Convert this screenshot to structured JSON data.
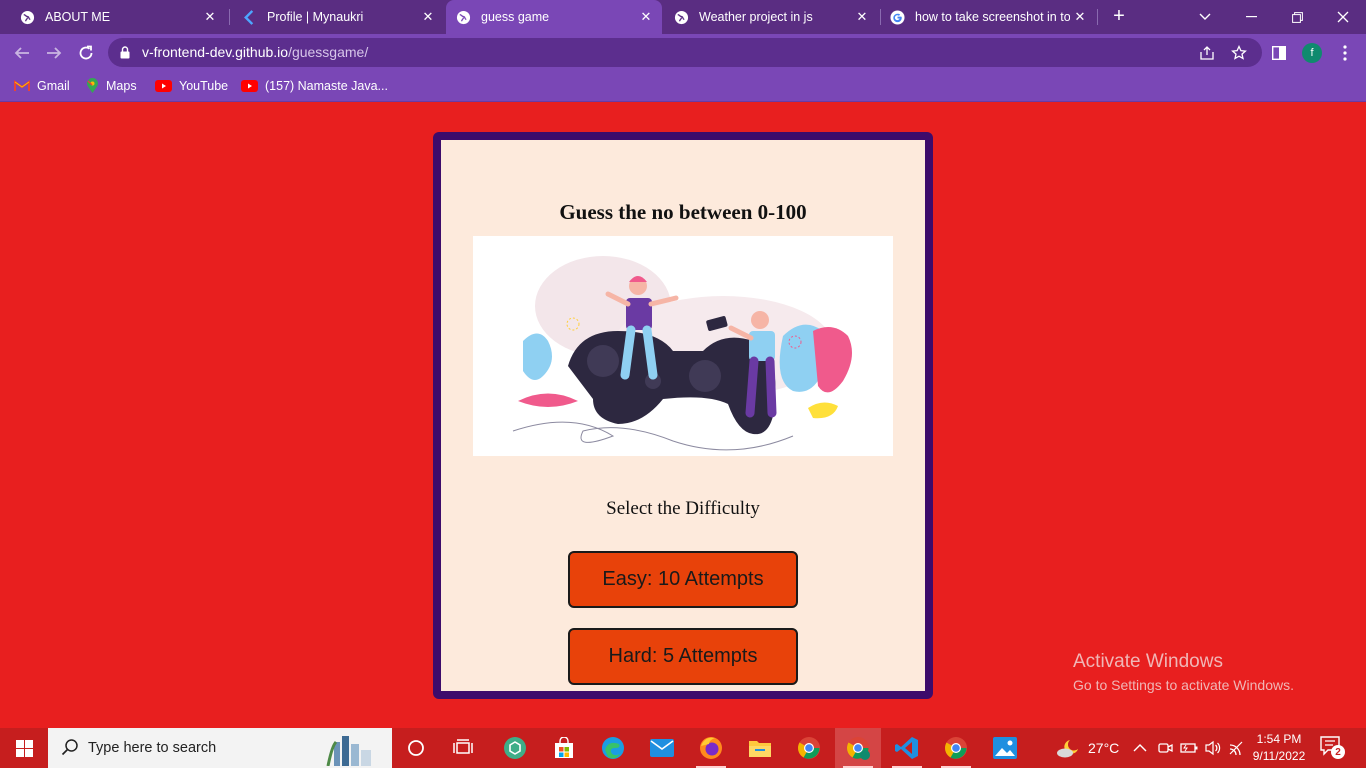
{
  "browser": {
    "tabs": [
      {
        "title": "ABOUT ME",
        "icon": "globe-icon"
      },
      {
        "title": "Profile | Mynaukri",
        "icon": "naukri-icon"
      },
      {
        "title": "guess game",
        "icon": "globe-icon",
        "active": true
      },
      {
        "title": "Weather project in js",
        "icon": "globe-icon"
      },
      {
        "title": "how to take screenshot in to",
        "icon": "google-icon"
      }
    ],
    "url_domain": "v-frontend-dev.github.io",
    "url_path": "/guessgame/",
    "profile_initial": "f",
    "bookmarks": [
      {
        "label": "Gmail",
        "icon": "gmail-icon"
      },
      {
        "label": "Maps",
        "icon": "maps-icon"
      },
      {
        "label": "YouTube",
        "icon": "youtube-icon"
      },
      {
        "label": "(157) Namaste Java...",
        "icon": "youtube-icon"
      }
    ],
    "theme_color": "#7a47b6"
  },
  "page": {
    "title": "Guess the no between 0-100",
    "difficulty_prompt": "Select the Difficulty",
    "buttons": {
      "easy": "Easy: 10 Attempts",
      "hard": "Hard: 5 Attempts"
    },
    "background_color": "#e81f1f",
    "card_border_color": "#3d0b6b",
    "button_color": "#e8420a"
  },
  "watermark": {
    "line1": "Activate Windows",
    "line2": "Go to Settings to activate Windows."
  },
  "taskbar": {
    "search_placeholder": "Type here to search",
    "temperature": "27°C",
    "time": "1:54 PM",
    "date": "9/11/2022",
    "notification_count": "2"
  }
}
